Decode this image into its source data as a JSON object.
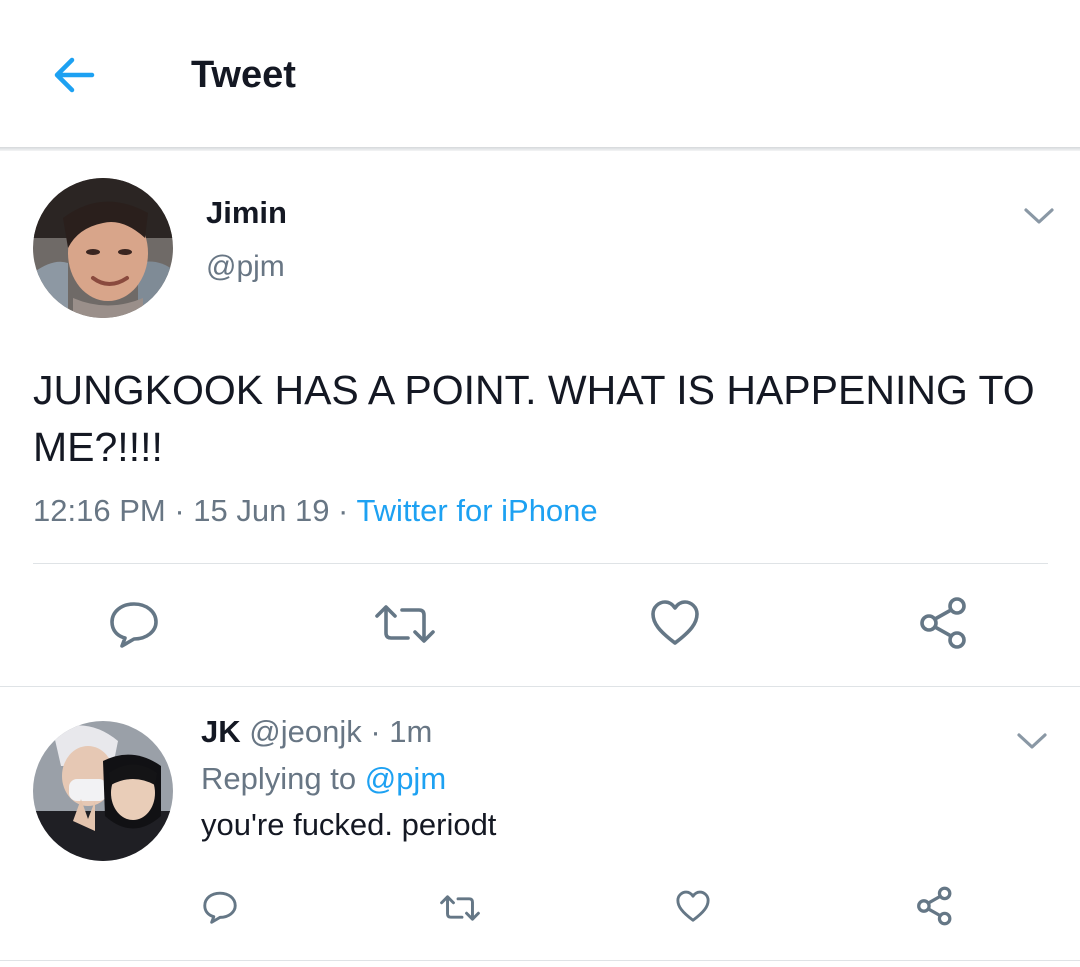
{
  "colors": {
    "accent": "#1da1f2",
    "secondary_text": "#687684",
    "primary_text": "#141823"
  },
  "header": {
    "back_icon": "arrow-left-icon",
    "title": "Tweet"
  },
  "tweet": {
    "avatar_icon": "user-avatar-photo",
    "name": "Jimin",
    "handle": "@pjm",
    "text": "JUNGKOOK HAS A POINT. WHAT IS HAPPENING TO ME?!!!!",
    "time": "12:16 PM",
    "separator": " · ",
    "date": "15 Jun 19",
    "source": "Twitter for iPhone",
    "menu_icon": "chevron-down-icon",
    "actions": [
      {
        "name": "reply-button",
        "icon": "speech-bubble-icon"
      },
      {
        "name": "retweet-button",
        "icon": "retweet-icon"
      },
      {
        "name": "like-button",
        "icon": "heart-icon"
      },
      {
        "name": "share-button",
        "icon": "share-icon"
      }
    ]
  },
  "reply": {
    "avatar_icon": "user-avatar-photo",
    "name": "JK",
    "handle": "@jeonjk",
    "age": "1m",
    "replying_prefix": "Replying to ",
    "replying_to": "@pjm",
    "text": "you're fucked. periodt",
    "menu_icon": "chevron-down-icon"
  }
}
